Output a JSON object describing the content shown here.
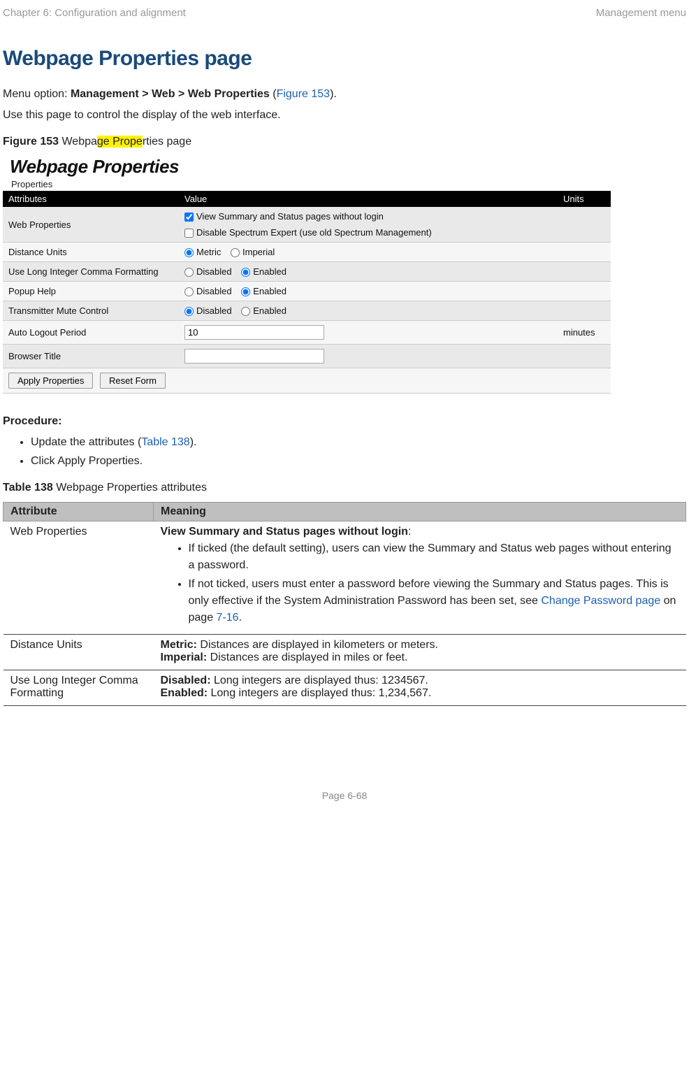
{
  "header": {
    "left": "Chapter 6:  Configuration and alignment",
    "right": "Management menu"
  },
  "title": "Webpage Properties page",
  "intro": {
    "p1_prefix": "Menu option: ",
    "p1_bold": "Management > Web > Web Properties",
    "p1_paren_open": " (",
    "p1_link": "Figure 153",
    "p1_paren_close": ").",
    "p2": "Use this page to control the display of the web interface."
  },
  "figcap": {
    "pre": "Figure 153  ",
    "plain1": "Webpa",
    "hl": "ge Prope",
    "plain2": "rties page"
  },
  "shot": {
    "title": "Webpage Properties",
    "subtitle": "Properties",
    "head": {
      "attr": "Attributes",
      "val": "Value",
      "unit": "Units"
    },
    "rows": {
      "web": {
        "label": "Web Properties",
        "chk1": "View Summary and Status pages without login",
        "chk2": "Disable Spectrum Expert (use old Spectrum Management)"
      },
      "dist": {
        "label": "Distance Units",
        "o1": "Metric",
        "o2": "Imperial"
      },
      "comma": {
        "label": "Use Long Integer Comma Formatting",
        "o1": "Disabled",
        "o2": "Enabled"
      },
      "popup": {
        "label": "Popup Help",
        "o1": "Disabled",
        "o2": "Enabled"
      },
      "mute": {
        "label": "Transmitter Mute Control",
        "o1": "Disabled",
        "o2": "Enabled"
      },
      "logout": {
        "label": "Auto Logout Period",
        "value": "10",
        "unit": "minutes"
      },
      "btitle": {
        "label": "Browser Title",
        "value": ""
      }
    },
    "buttons": {
      "apply": "Apply Properties",
      "reset": "Reset Form"
    }
  },
  "procedure": {
    "heading": "Procedure:",
    "i1_pre": "Update the attributes (",
    "i1_link": "Table 138",
    "i1_post": ").",
    "i2": "Click Apply Properties."
  },
  "tbl_caption": {
    "bold": "Table 138  ",
    "rest": "Webpage Properties attributes"
  },
  "tbl": {
    "h1": "Attribute",
    "h2": "Meaning",
    "r1": {
      "attr": "Web Properties",
      "lead_bold": "View Summary and Status pages without login",
      "lead_colon": ":",
      "b1": "If ticked (the default setting), users can view the Summary and Status web pages without entering a password.",
      "b2_a": "If not ticked, users must enter a password before viewing the Summary and Status pages. This is only effective if the System Administration Password has been set, see ",
      "b2_link": "Change Password page",
      "b2_b": " on page ",
      "b2_link2": "7-16",
      "b2_c": "."
    },
    "r2": {
      "attr": "Distance Units",
      "l1b": "Metric:",
      "l1": " Distances are displayed in kilometers or meters.",
      "l2b": "Imperial:",
      "l2": " Distances are displayed in miles or feet."
    },
    "r3": {
      "attr": "Use Long Integer Comma Formatting",
      "l1b": "Disabled:",
      "l1": " Long integers are displayed thus: 1234567.",
      "l2b": "Enabled:",
      "l2": " Long integers are displayed thus: 1,234,567."
    }
  },
  "footer": "Page 6-68"
}
